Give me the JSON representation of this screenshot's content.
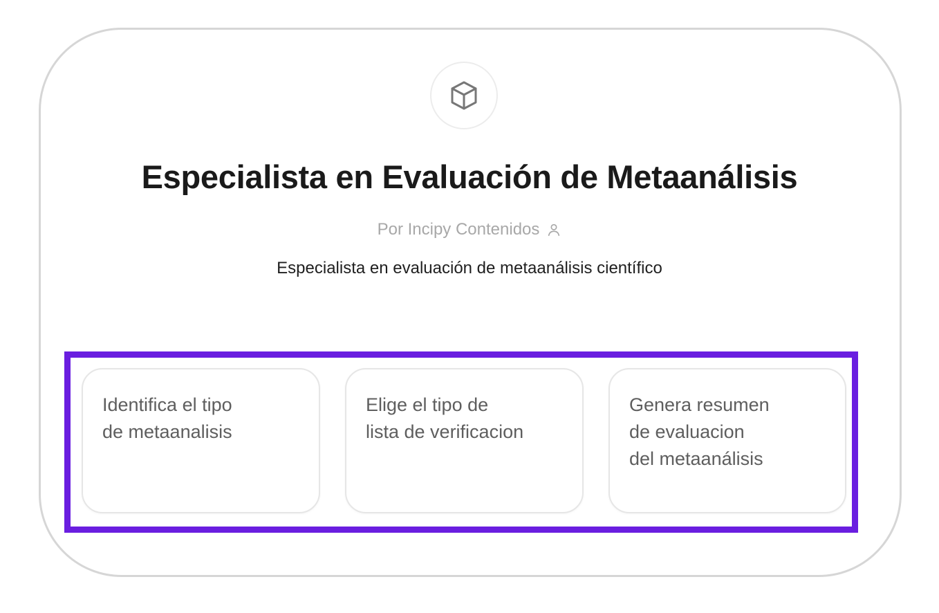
{
  "gpt": {
    "icon": "cube-icon",
    "title": "Especialista en Evaluación de Metaanálisis",
    "author": "Por Incipy Contenidos",
    "author_icon": "user-icon",
    "description": "Especialista en evaluación de metaanálisis científico"
  },
  "conversation_starters": [
    {
      "label": "Identifica el tipo\nde metaanalisis"
    },
    {
      "label": "Elige el tipo de\nlista de verificacion"
    },
    {
      "label": "Genera resumen\nde evaluacion\ndel metaanálisis"
    }
  ],
  "colors": {
    "highlight": "#6a1ee0",
    "frame_border": "#d6d6d6",
    "title": "#1a1a1a",
    "author": "#a8a8a8",
    "card_text": "#5e5e5e"
  }
}
